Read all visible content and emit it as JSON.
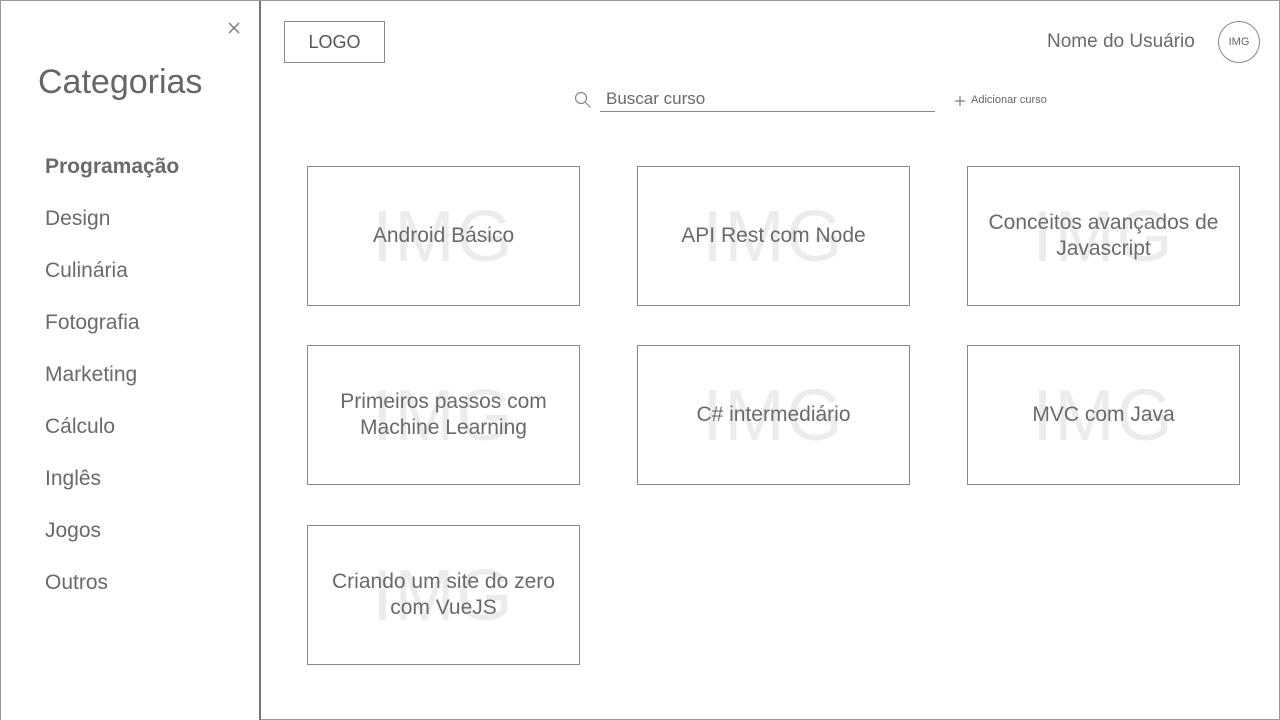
{
  "sidebar": {
    "title": "Categorias",
    "close_icon": "close-icon",
    "items": [
      {
        "label": "Programação",
        "active": true
      },
      {
        "label": "Design"
      },
      {
        "label": "Culinária"
      },
      {
        "label": "Fotografia"
      },
      {
        "label": "Marketing"
      },
      {
        "label": "Cálculo"
      },
      {
        "label": "Inglês"
      },
      {
        "label": "Jogos"
      },
      {
        "label": "Outros"
      }
    ]
  },
  "header": {
    "logo": "LOGO",
    "user_name": "Nome do Usuário",
    "avatar": "IMG"
  },
  "search": {
    "placeholder": "Buscar curso",
    "icon": "search-icon",
    "add_course_label": "Adicionar curso",
    "add_icon": "plus-icon"
  },
  "courses": [
    {
      "title": "Android Básico",
      "image": "IMG"
    },
    {
      "title": "API Rest com Node",
      "image": "IMG"
    },
    {
      "title": "Conceitos avançados de Javascript",
      "image": "IMG"
    },
    {
      "title": "Primeiros passos com Machine Learning",
      "image": "IMG"
    },
    {
      "title": "C# intermediário",
      "image": "IMG"
    },
    {
      "title": "MVC com Java",
      "image": "IMG"
    },
    {
      "title": "Criando um site do zero com VueJS",
      "image": "IMG"
    }
  ]
}
